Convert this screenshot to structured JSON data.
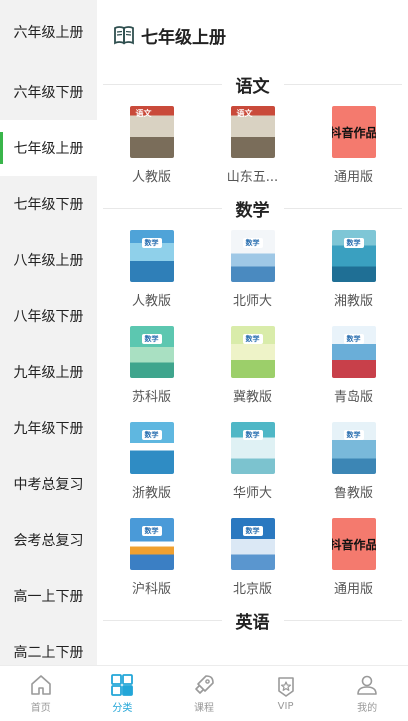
{
  "sidebar": {
    "items": [
      {
        "label": "六年级上册"
      },
      {
        "label": "六年级下册"
      },
      {
        "label": "七年级上册"
      },
      {
        "label": "七年级下册"
      },
      {
        "label": "八年级上册"
      },
      {
        "label": "八年级下册"
      },
      {
        "label": "九年级上册"
      },
      {
        "label": "九年级下册"
      },
      {
        "label": "中考总复习"
      },
      {
        "label": "会考总复习"
      },
      {
        "label": "高一上下册"
      },
      {
        "label": "高二上下册"
      }
    ],
    "active_index": 2,
    "accent_color": "#39b54a"
  },
  "header": {
    "title": "七年级上册",
    "icon": "book-icon"
  },
  "sections": [
    {
      "title": "语文",
      "books": [
        {
          "label": "人教版",
          "cover_text": "语文"
        },
        {
          "label": "山东五...",
          "cover_text": "语文"
        },
        {
          "label": "通用版",
          "cover_text": "抖音作品"
        }
      ]
    },
    {
      "title": "数学",
      "books": [
        {
          "label": "人教版",
          "cover_text": "数学"
        },
        {
          "label": "北师大",
          "cover_text": "数学"
        },
        {
          "label": "湘教版",
          "cover_text": "数学"
        },
        {
          "label": "苏科版",
          "cover_text": "数学"
        },
        {
          "label": "冀教版",
          "cover_text": "数学"
        },
        {
          "label": "青岛版",
          "cover_text": "数学"
        },
        {
          "label": "浙教版",
          "cover_text": "数学"
        },
        {
          "label": "华师大",
          "cover_text": "数学"
        },
        {
          "label": "鲁教版",
          "cover_text": "数学"
        },
        {
          "label": "沪科版",
          "cover_text": "数学"
        },
        {
          "label": "北京版",
          "cover_text": "数学"
        },
        {
          "label": "通用版",
          "cover_text": "抖音作品"
        }
      ]
    },
    {
      "title": "英语",
      "books": []
    }
  ],
  "tabbar": {
    "items": [
      {
        "label": "首页",
        "icon": "home-icon"
      },
      {
        "label": "分类",
        "icon": "category-grid-icon"
      },
      {
        "label": "课程",
        "icon": "rocket-icon"
      },
      {
        "label": "VIP",
        "icon": "vip-badge-icon"
      },
      {
        "label": "我的",
        "icon": "user-icon"
      }
    ],
    "active_index": 1,
    "active_color": "#22a6d8"
  }
}
